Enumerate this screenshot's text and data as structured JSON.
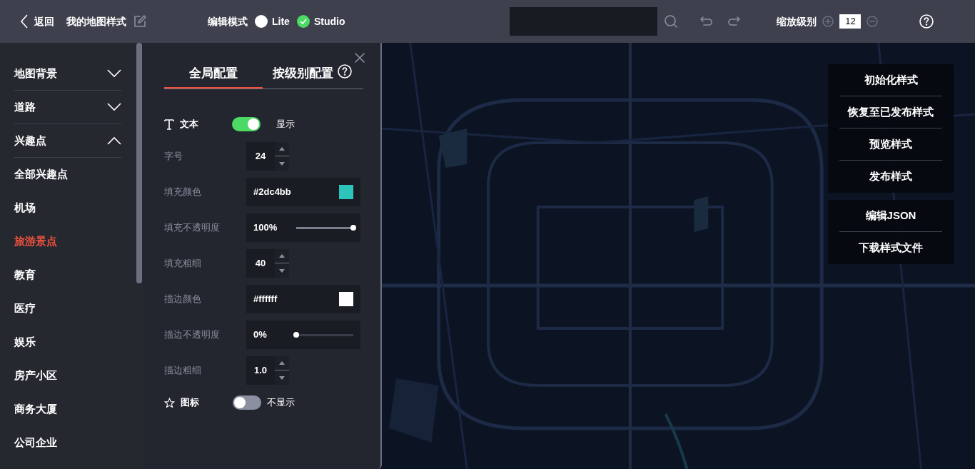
{
  "top_bar": {
    "back": "返回",
    "title": "我的地图样式",
    "mode_label": "编辑模式",
    "modes": [
      {
        "label": "Lite",
        "selected": false
      },
      {
        "label": "Studio",
        "selected": true
      }
    ],
    "zoom_label": "缩放级别",
    "zoom_value": "12"
  },
  "sidebar": {
    "items": [
      {
        "label": "地图背景",
        "expanded": false
      },
      {
        "label": "道路",
        "expanded": false
      },
      {
        "label": "兴趣点",
        "expanded": true,
        "children": [
          {
            "label": "全部兴趣点",
            "selected": false
          },
          {
            "label": "机场",
            "selected": false
          },
          {
            "label": "旅游景点",
            "selected": true
          },
          {
            "label": "教育",
            "selected": false
          },
          {
            "label": "医疗",
            "selected": false
          },
          {
            "label": "娱乐",
            "selected": false
          },
          {
            "label": "房产小区",
            "selected": false
          },
          {
            "label": "商务大厦",
            "selected": false
          },
          {
            "label": "公司企业",
            "selected": false
          }
        ]
      }
    ]
  },
  "panel": {
    "tabs": [
      {
        "label": "全局配置",
        "selected": true
      },
      {
        "label": "按级别配置",
        "selected": false
      }
    ],
    "text_section": {
      "label": "文本",
      "on": true,
      "state_label": "显示"
    },
    "fields": [
      {
        "kind": "number",
        "label": "字号",
        "value": "24"
      },
      {
        "kind": "color",
        "label": "填充颜色",
        "value": "#2dc4bb",
        "color": "#2dc4bb"
      },
      {
        "kind": "slider",
        "label": "填充不透明度",
        "value": "100%",
        "level": 1
      },
      {
        "kind": "number",
        "label": "填充粗细",
        "value": "40"
      },
      {
        "kind": "color",
        "label": "描边颜色",
        "value": "#ffffff",
        "color": "#ffffff"
      },
      {
        "kind": "slider",
        "label": "描边不透明度",
        "value": "0%",
        "level": 0
      },
      {
        "kind": "number",
        "label": "描边粗细",
        "value": "1.0"
      }
    ],
    "icon_section": {
      "label": "图标",
      "on": false,
      "state_label": "不显示"
    }
  },
  "map": {
    "action_groups": [
      [
        "初始化样式",
        "恢复至已发布样式",
        "预览样式",
        "发布样式"
      ],
      [
        "编辑JSON",
        "下载样式文件"
      ]
    ]
  }
}
